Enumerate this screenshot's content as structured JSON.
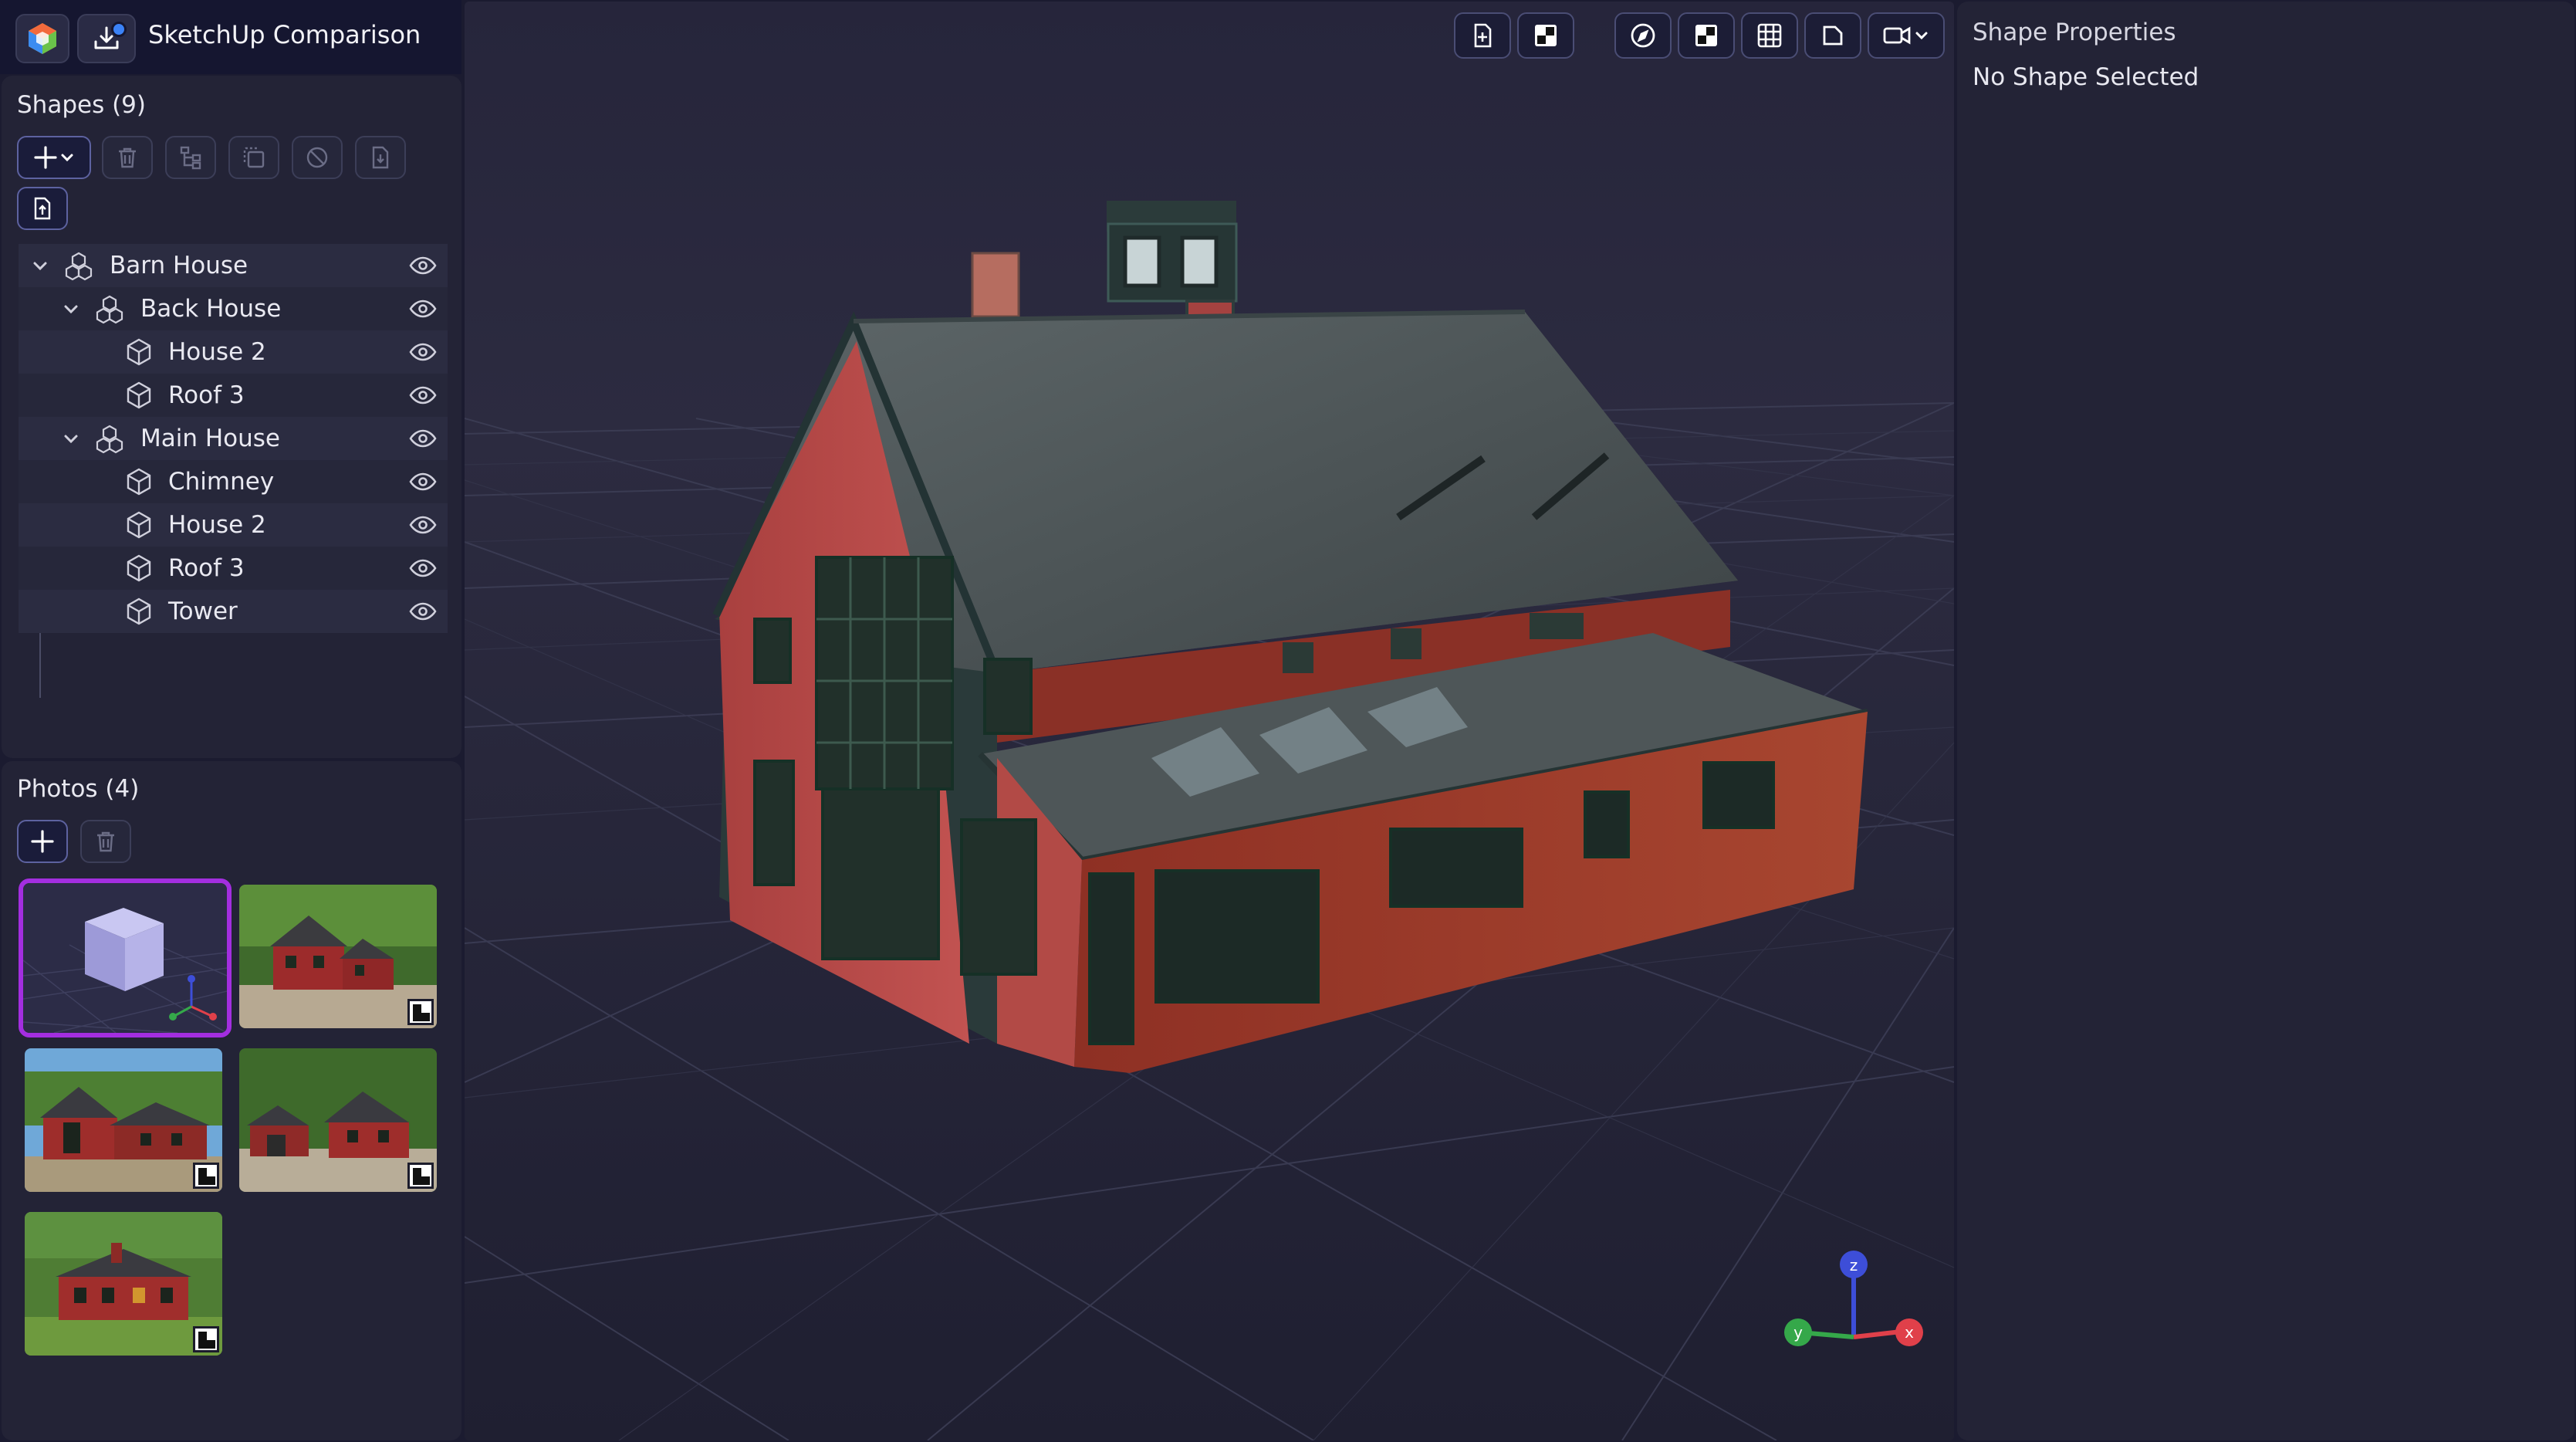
{
  "app": {
    "title": "SketchUp Comparison"
  },
  "shapes": {
    "title": "Shapes (9)",
    "toolbar": [
      {
        "name": "add-shape-button",
        "icon": "plus-chevron-icon"
      },
      {
        "name": "delete-shape-button",
        "icon": "trash-icon"
      },
      {
        "name": "group-shapes-button",
        "icon": "hierarchy-icon"
      },
      {
        "name": "duplicate-shape-button",
        "icon": "duplicate-icon"
      },
      {
        "name": "hide-shape-button",
        "icon": "ban-icon"
      },
      {
        "name": "import-shape-button",
        "icon": "file-import-icon"
      },
      {
        "name": "export-shape-button",
        "icon": "file-export-icon"
      }
    ],
    "tree": [
      {
        "label": "Barn House",
        "level": 0,
        "kind": "group",
        "expanded": true
      },
      {
        "label": "Back House",
        "level": 1,
        "kind": "group",
        "expanded": true
      },
      {
        "label": "House 2",
        "level": 2,
        "kind": "shape"
      },
      {
        "label": "Roof 3",
        "level": 2,
        "kind": "shape"
      },
      {
        "label": "Main House",
        "level": 1,
        "kind": "group",
        "expanded": true
      },
      {
        "label": "Chimney",
        "level": 2,
        "kind": "shape"
      },
      {
        "label": "House 2",
        "level": 2,
        "kind": "shape"
      },
      {
        "label": "Roof 3",
        "level": 2,
        "kind": "shape"
      },
      {
        "label": "Tower",
        "level": 2,
        "kind": "shape"
      }
    ]
  },
  "photos": {
    "title": "Photos (4)",
    "toolbar": [
      {
        "name": "add-photo-button",
        "icon": "plus-icon"
      },
      {
        "name": "delete-photo-button",
        "icon": "trash-icon"
      }
    ],
    "thumbnails": [
      {
        "kind": "model-view",
        "selected": true
      },
      {
        "kind": "photo",
        "variant": "front-right"
      },
      {
        "kind": "photo",
        "variant": "front-left"
      },
      {
        "kind": "photo",
        "variant": "wide"
      },
      {
        "kind": "photo",
        "variant": "side"
      }
    ]
  },
  "viewport": {
    "toolbar": [
      {
        "name": "add-photo-button",
        "icon": "file-plus-icon"
      },
      {
        "name": "marker-button",
        "icon": "checker-icon"
      },
      {
        "name": "compass-button",
        "icon": "compass-icon"
      },
      {
        "name": "texture-button",
        "icon": "checker-icon"
      },
      {
        "name": "grid-button",
        "icon": "grid-icon"
      },
      {
        "name": "shape-button",
        "icon": "square-icon"
      },
      {
        "name": "camera-button",
        "icon": "video-camera-icon"
      }
    ],
    "axes": {
      "x": "x",
      "y": "y",
      "z": "z"
    }
  },
  "properties": {
    "title": "Shape Properties",
    "empty_message": "No Shape Selected"
  },
  "colors": {
    "accent": "#a32ee0",
    "panel": "#232336",
    "background": "#1b1b30",
    "axis_x": "#e0404a",
    "axis_y": "#35a84a",
    "axis_z": "#3d4ed8"
  }
}
